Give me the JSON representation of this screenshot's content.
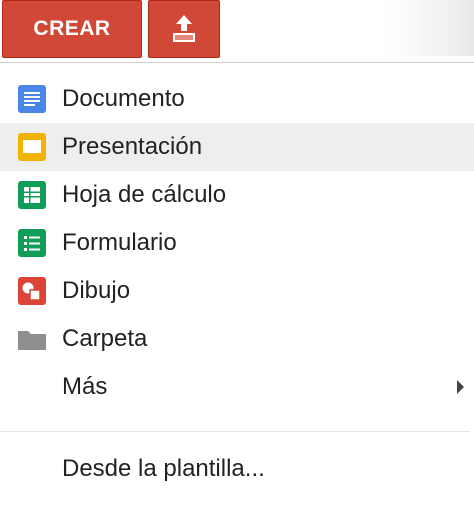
{
  "toolbar": {
    "create_label": "CREAR",
    "upload_icon": "upload-icon",
    "accent": "#d14836"
  },
  "menu": {
    "items": [
      {
        "label": "Documento",
        "icon": "document-icon",
        "color": "#4a86e8"
      },
      {
        "label": "Presentación",
        "icon": "presentation-icon",
        "color": "#f1b300"
      },
      {
        "label": "Hoja de cálculo",
        "icon": "spreadsheet-icon",
        "color": "#0f9d58"
      },
      {
        "label": "Formulario",
        "icon": "form-icon",
        "color": "#0f9d58"
      },
      {
        "label": "Dibujo",
        "icon": "drawing-icon",
        "color": "#db4437"
      },
      {
        "label": "Carpeta",
        "icon": "folder-icon",
        "color": "#8f8f8f"
      },
      {
        "label": "Más",
        "icon": "chevron-right-icon"
      }
    ],
    "from_template_label": "Desde la plantilla..."
  }
}
